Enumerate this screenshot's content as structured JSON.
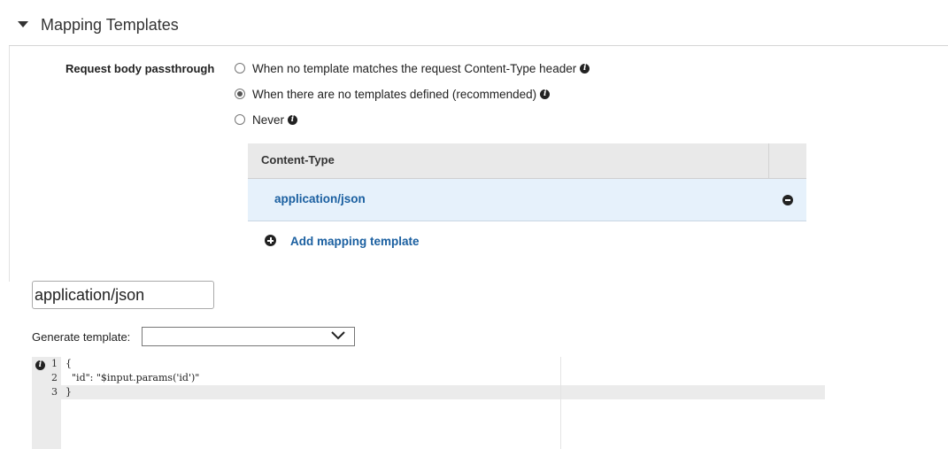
{
  "section": {
    "title": "Mapping Templates"
  },
  "passthrough": {
    "label": "Request body passthrough",
    "options": [
      {
        "label": "When no template matches the request Content-Type header",
        "selected": false
      },
      {
        "label": "When there are no templates defined (recommended)",
        "selected": true
      },
      {
        "label": "Never",
        "selected": false
      }
    ]
  },
  "content_type_table": {
    "header": "Content-Type",
    "rows": [
      {
        "value": "application/json"
      }
    ],
    "add_label": "Add mapping template"
  },
  "content_type_input": {
    "value": "application/json"
  },
  "generate_template": {
    "label": "Generate template:",
    "selected": ""
  },
  "editor": {
    "line_numbers": [
      "1",
      "2",
      "3"
    ],
    "lines": [
      "{",
      "  \"id\": \"$input.params('id')\"",
      "}"
    ],
    "active_line": 3
  },
  "colors": {
    "link": "#1a5fa0",
    "row_selected_bg": "#e6f1fb",
    "table_header_bg": "#e9e9e9"
  },
  "icons": [
    "caret-down-icon",
    "info-icon",
    "remove-icon",
    "add-icon",
    "chevron-down-icon"
  ]
}
